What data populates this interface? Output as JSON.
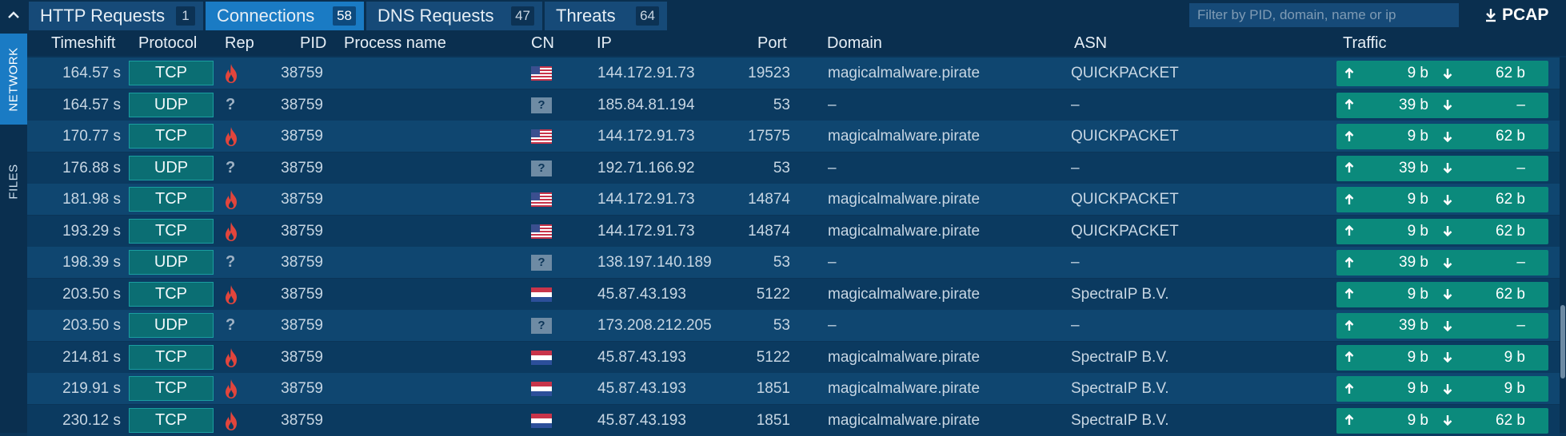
{
  "tabs": [
    {
      "label": "HTTP Requests",
      "count": "1"
    },
    {
      "label": "Connections",
      "count": "58"
    },
    {
      "label": "DNS Requests",
      "count": "47"
    },
    {
      "label": "Threats",
      "count": "64"
    }
  ],
  "filter": {
    "placeholder": "Filter by PID, domain, name or ip"
  },
  "pcap": {
    "label": "PCAP"
  },
  "sidenav": {
    "network": "NETWORK",
    "files": "FILES"
  },
  "columns": {
    "timeshift": "Timeshift",
    "protocol": "Protocol",
    "rep": "Rep",
    "pid": "PID",
    "process": "Process name",
    "cn": "CN",
    "ip": "IP",
    "port": "Port",
    "domain": "Domain",
    "asn": "ASN",
    "traffic": "Traffic"
  },
  "colors": {
    "active_tab": "#1a7bc4",
    "protocol": "#0b6e73",
    "traffic": "#0b8a7c",
    "danger": "#e2453c"
  },
  "rows": [
    {
      "time": "164.57 s",
      "proto": "TCP",
      "rep": "fire",
      "pid": "38759",
      "process": "",
      "cn": "us",
      "ip": "144.172.91.73",
      "port": "19523",
      "domain": "magicalmalware.pirate",
      "asn": "QUICKPACKET",
      "up": "9 b",
      "down": "62 b"
    },
    {
      "time": "164.57 s",
      "proto": "UDP",
      "rep": "?",
      "pid": "38759",
      "process": "",
      "cn": "unknown",
      "ip": "185.84.81.194",
      "port": "53",
      "domain": "–",
      "asn": "–",
      "up": "39 b",
      "down": "–"
    },
    {
      "time": "170.77 s",
      "proto": "TCP",
      "rep": "fire",
      "pid": "38759",
      "process": "",
      "cn": "us",
      "ip": "144.172.91.73",
      "port": "17575",
      "domain": "magicalmalware.pirate",
      "asn": "QUICKPACKET",
      "up": "9 b",
      "down": "62 b"
    },
    {
      "time": "176.88 s",
      "proto": "UDP",
      "rep": "?",
      "pid": "38759",
      "process": "",
      "cn": "unknown",
      "ip": "192.71.166.92",
      "port": "53",
      "domain": "–",
      "asn": "–",
      "up": "39 b",
      "down": "–"
    },
    {
      "time": "181.98 s",
      "proto": "TCP",
      "rep": "fire",
      "pid": "38759",
      "process": "",
      "cn": "us",
      "ip": "144.172.91.73",
      "port": "14874",
      "domain": "magicalmalware.pirate",
      "asn": "QUICKPACKET",
      "up": "9 b",
      "down": "62 b"
    },
    {
      "time": "193.29 s",
      "proto": "TCP",
      "rep": "fire",
      "pid": "38759",
      "process": "",
      "cn": "us",
      "ip": "144.172.91.73",
      "port": "14874",
      "domain": "magicalmalware.pirate",
      "asn": "QUICKPACKET",
      "up": "9 b",
      "down": "62 b"
    },
    {
      "time": "198.39 s",
      "proto": "UDP",
      "rep": "?",
      "pid": "38759",
      "process": "",
      "cn": "unknown",
      "ip": "138.197.140.189",
      "port": "53",
      "domain": "–",
      "asn": "–",
      "up": "39 b",
      "down": "–"
    },
    {
      "time": "203.50 s",
      "proto": "TCP",
      "rep": "fire",
      "pid": "38759",
      "process": "",
      "cn": "nl",
      "ip": "45.87.43.193",
      "port": "5122",
      "domain": "magicalmalware.pirate",
      "asn": "SpectraIP B.V.",
      "up": "9 b",
      "down": "62 b"
    },
    {
      "time": "203.50 s",
      "proto": "UDP",
      "rep": "?",
      "pid": "38759",
      "process": "",
      "cn": "unknown",
      "ip": "173.208.212.205",
      "port": "53",
      "domain": "–",
      "asn": "–",
      "up": "39 b",
      "down": "–"
    },
    {
      "time": "214.81 s",
      "proto": "TCP",
      "rep": "fire",
      "pid": "38759",
      "process": "",
      "cn": "nl",
      "ip": "45.87.43.193",
      "port": "5122",
      "domain": "magicalmalware.pirate",
      "asn": "SpectraIP B.V.",
      "up": "9 b",
      "down": "9 b"
    },
    {
      "time": "219.91 s",
      "proto": "TCP",
      "rep": "fire",
      "pid": "38759",
      "process": "",
      "cn": "nl",
      "ip": "45.87.43.193",
      "port": "1851",
      "domain": "magicalmalware.pirate",
      "asn": "SpectraIP B.V.",
      "up": "9 b",
      "down": "9 b"
    },
    {
      "time": "230.12 s",
      "proto": "TCP",
      "rep": "fire",
      "pid": "38759",
      "process": "",
      "cn": "nl",
      "ip": "45.87.43.193",
      "port": "1851",
      "domain": "magicalmalware.pirate",
      "asn": "SpectraIP B.V.",
      "up": "9 b",
      "down": "62 b"
    }
  ]
}
